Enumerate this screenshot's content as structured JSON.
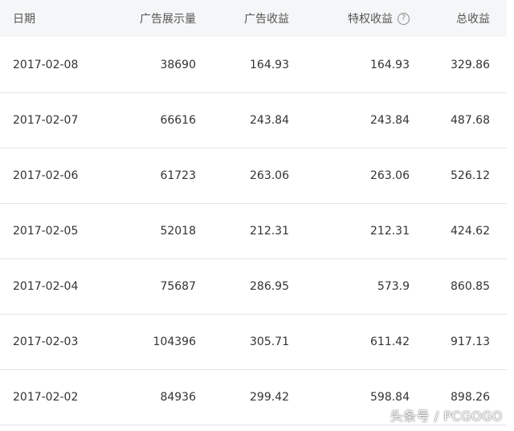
{
  "table": {
    "headers": {
      "date": "日期",
      "impressions": "广告展示量",
      "ad_revenue": "广告收益",
      "privilege_revenue": "特权收益",
      "total_revenue": "总收益"
    },
    "help_icon": "question-circle-icon",
    "rows": [
      {
        "date": "2017-02-08",
        "impressions": "38690",
        "ad_revenue": "164.93",
        "privilege_revenue": "164.93",
        "total_revenue": "329.86"
      },
      {
        "date": "2017-02-07",
        "impressions": "66616",
        "ad_revenue": "243.84",
        "privilege_revenue": "243.84",
        "total_revenue": "487.68"
      },
      {
        "date": "2017-02-06",
        "impressions": "61723",
        "ad_revenue": "263.06",
        "privilege_revenue": "263.06",
        "total_revenue": "526.12"
      },
      {
        "date": "2017-02-05",
        "impressions": "52018",
        "ad_revenue": "212.31",
        "privilege_revenue": "212.31",
        "total_revenue": "424.62"
      },
      {
        "date": "2017-02-04",
        "impressions": "75687",
        "ad_revenue": "286.95",
        "privilege_revenue": "573.9",
        "total_revenue": "860.85"
      },
      {
        "date": "2017-02-03",
        "impressions": "104396",
        "ad_revenue": "305.71",
        "privilege_revenue": "611.42",
        "total_revenue": "917.13"
      },
      {
        "date": "2017-02-02",
        "impressions": "84936",
        "ad_revenue": "299.42",
        "privilege_revenue": "598.84",
        "total_revenue": "898.26"
      }
    ]
  },
  "watermark": "头条号 / PCGOGO",
  "colors": {
    "header_bg": "#f5f6f7",
    "row_border": "#e6e6e6",
    "text": "#333333"
  }
}
